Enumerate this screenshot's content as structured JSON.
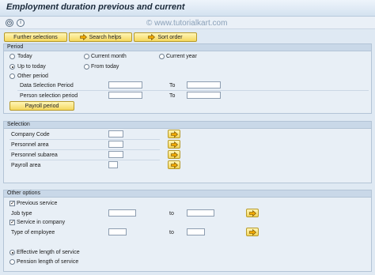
{
  "window": {
    "title": "Employment duration previous and current",
    "watermark": "© www.tutorialkart.com"
  },
  "toolbar": {
    "icons": [
      "execute-icon",
      "info-icon"
    ]
  },
  "app_toolbar": {
    "further_selections": "Further selections",
    "search_helps": "Search helps",
    "sort_order": "Sort order"
  },
  "period": {
    "title": "Period",
    "today": "Today",
    "current_month": "Current month",
    "current_year": "Current year",
    "up_to_today": "Up to today",
    "from_today": "From today",
    "other_period": "Other period",
    "selected": "up_to_today",
    "data_selection_period": "Data Selection Period",
    "person_selection_period": "Person selection period",
    "to": "To",
    "payroll_period": "Payroll period"
  },
  "selection": {
    "title": "Selection",
    "fields": [
      {
        "label": "Company Code",
        "value": ""
      },
      {
        "label": "Personnel area",
        "value": ""
      },
      {
        "label": "Personnel subarea",
        "value": ""
      },
      {
        "label": "Payroll area",
        "value": ""
      }
    ]
  },
  "other_options": {
    "title": "Other options",
    "previous_service": "Previous service",
    "previous_service_checked": true,
    "job_type": "Job type",
    "service_in_company": "Service in company",
    "service_in_company_checked": true,
    "type_of_employee": "Type of employee",
    "to": "to",
    "effective_length": "Effective length of service",
    "pension_length": "Pension length of service",
    "selected_length": "effective"
  }
}
